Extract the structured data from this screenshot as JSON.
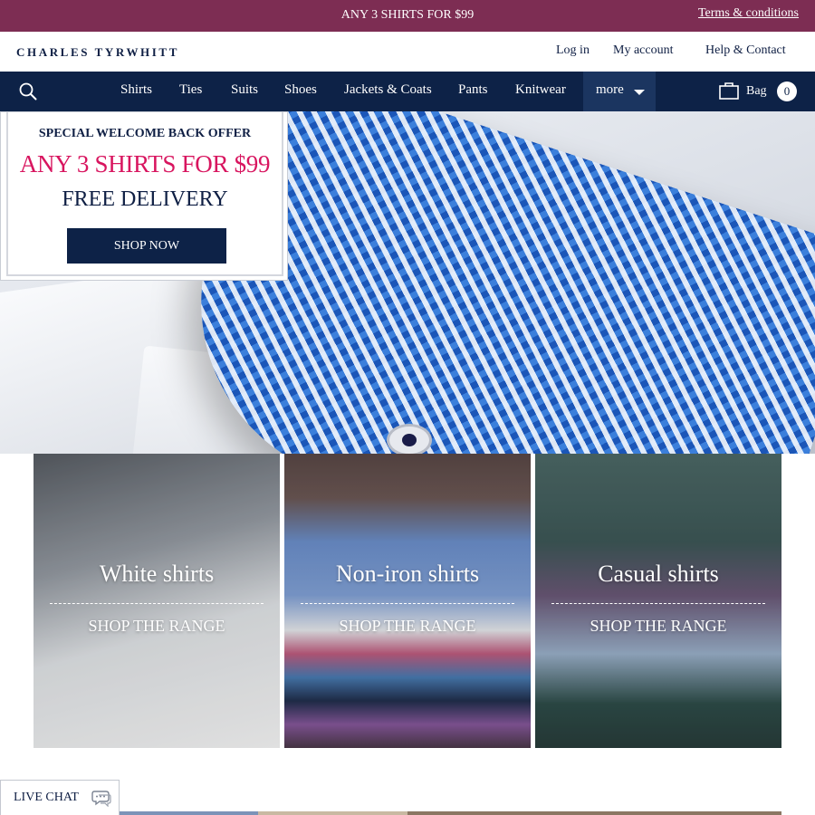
{
  "promo_strip": {
    "text": "ANY 3 SHIRTS FOR $99",
    "terms_link": "Terms & conditions"
  },
  "header": {
    "logo": "CHARLES TYRWHITT",
    "links": {
      "login": "Log in",
      "account": "My account",
      "help": "Help & Contact"
    }
  },
  "nav": {
    "items": [
      "Shirts",
      "Ties",
      "Suits",
      "Shoes",
      "Jackets & Coats",
      "Pants",
      "Knitwear"
    ],
    "more_label": "more",
    "bag_label": "Bag",
    "bag_count": "0",
    "search_icon": "search-icon",
    "bag_icon": "shopping-bag-icon"
  },
  "hero": {
    "offer_title": "SPECIAL WELCOME BACK OFFER",
    "offer_main": "ANY 3 SHIRTS FOR $99",
    "offer_sub": "FREE DELIVERY",
    "cta_label": "SHOP NOW"
  },
  "tiles": [
    {
      "title": "White shirts",
      "cta": "SHOP THE RANGE"
    },
    {
      "title": "Non-iron shirts",
      "cta": "SHOP THE RANGE"
    },
    {
      "title": "Casual shirts",
      "cta": "SHOP THE RANGE"
    }
  ],
  "live_chat": {
    "label": "LIVE CHAT",
    "icon": "chat-bubble-icon"
  },
  "colors": {
    "promo_bg": "#7d2d53",
    "nav_bg": "#0d2247",
    "accent_pink": "#d8155f",
    "navy_text": "#0f1f44"
  }
}
